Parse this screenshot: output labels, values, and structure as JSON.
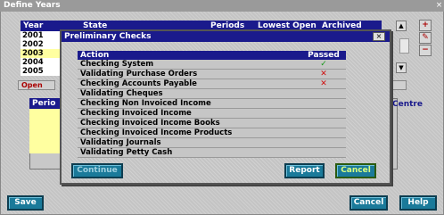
{
  "window": {
    "title": "Define Years",
    "close_glyph": "×"
  },
  "years_table": {
    "columns": [
      "Year",
      "State",
      "Periods",
      "Lowest Open",
      "Archived"
    ],
    "rows": [
      "2001",
      "2002",
      "2003",
      "2004",
      "2005"
    ],
    "selected_index": 2
  },
  "toolbar": {
    "add_glyph": "+",
    "edit_glyph": "✎",
    "remove_glyph": "−"
  },
  "scrollbar": {
    "up_glyph": "▲",
    "down_glyph": "▼"
  },
  "open_button_label": "Open",
  "periods_header": "Perio",
  "centre_label": "Centre",
  "bottom_buttons": {
    "save": "Save",
    "cancel": "Cancel",
    "help": "Help"
  },
  "dialog": {
    "title": "Preliminary Checks",
    "close_glyph": "×",
    "columns": {
      "action": "Action",
      "passed": "Passed"
    },
    "checks": [
      {
        "action": "Checking System",
        "passed": "✓",
        "status": "ok"
      },
      {
        "action": "Validating Purchase Orders",
        "passed": "✕",
        "status": "fail"
      },
      {
        "action": "Checking Accounts Payable",
        "passed": "✕",
        "status": "fail"
      },
      {
        "action": "Validating Cheques",
        "passed": "",
        "status": ""
      },
      {
        "action": "Checking Non Invoiced Income",
        "passed": "",
        "status": ""
      },
      {
        "action": "Checking Invoiced Income",
        "passed": "",
        "status": ""
      },
      {
        "action": "Checking Invoiced Income Books",
        "passed": "",
        "status": ""
      },
      {
        "action": "Checking Invoiced Income Products",
        "passed": "",
        "status": ""
      },
      {
        "action": "Validating Journals",
        "passed": "",
        "status": ""
      },
      {
        "action": "Validating Petty Cash",
        "passed": "",
        "status": ""
      }
    ],
    "buttons": {
      "continue": "Continue",
      "report": "Report",
      "cancel": "Cancel"
    }
  },
  "colors": {
    "header_navy": "#1a1a8c",
    "button_teal": "#1a7a9a",
    "selected_row": "#ffffa0",
    "pass_green": "#1a9a1a",
    "fail_red": "#d01010"
  }
}
